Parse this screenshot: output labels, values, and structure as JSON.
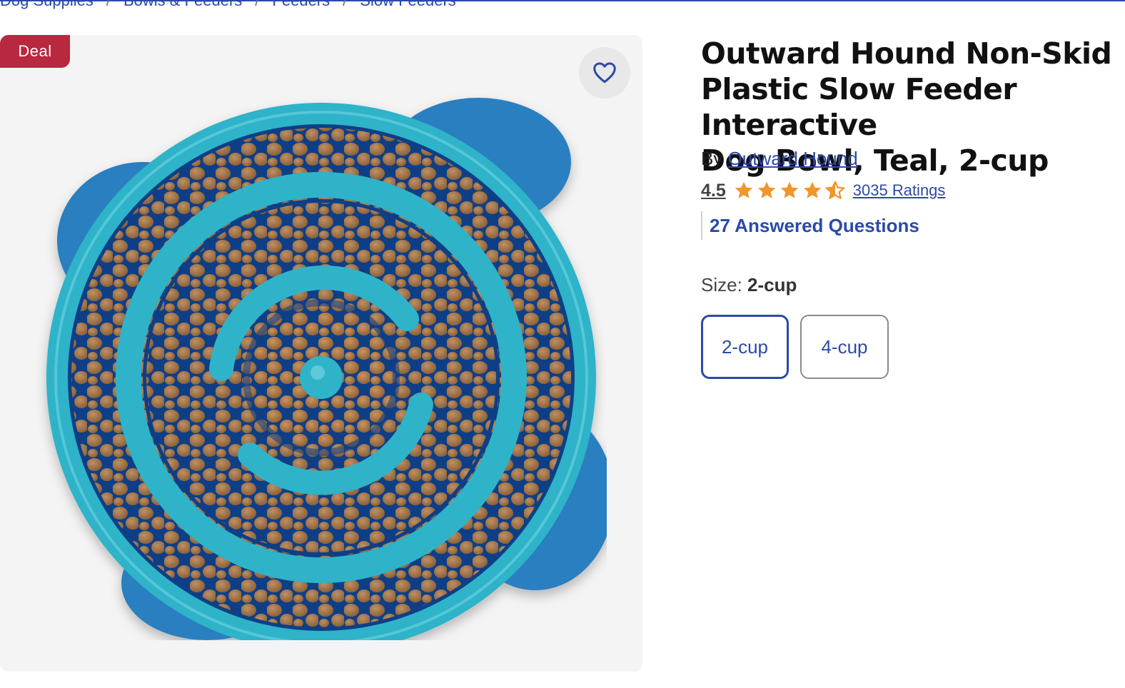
{
  "breadcrumb": {
    "items": [
      "Dog Supplies",
      "Bowls & Feeders",
      "Feeders",
      "Slow Feeders"
    ],
    "separator": "/"
  },
  "product": {
    "badge": "Deal",
    "title": "Outward Hound Non-Skid\nPlastic Slow Feeder Interactive\nDog Bowl, Teal, 2-cup",
    "by_label": "By",
    "brand": "Outward Hound",
    "rating": "4.5",
    "rating_stars": 4.5,
    "ratings_count_label": "3035 Ratings",
    "questions_label": "27 Answered Questions",
    "size_label": "Size:",
    "size_value": "2-cup",
    "size_options": [
      "2-cup",
      "4-cup"
    ],
    "selected_size": "2-cup"
  },
  "icons": {
    "favorite": "heart-outline-icon",
    "star": "star-icon"
  },
  "colors": {
    "brand_blue": "#2b4aa8",
    "deal_red": "#b8283f",
    "star_orange": "#f0962a",
    "image_bg": "#f4f4f4"
  }
}
